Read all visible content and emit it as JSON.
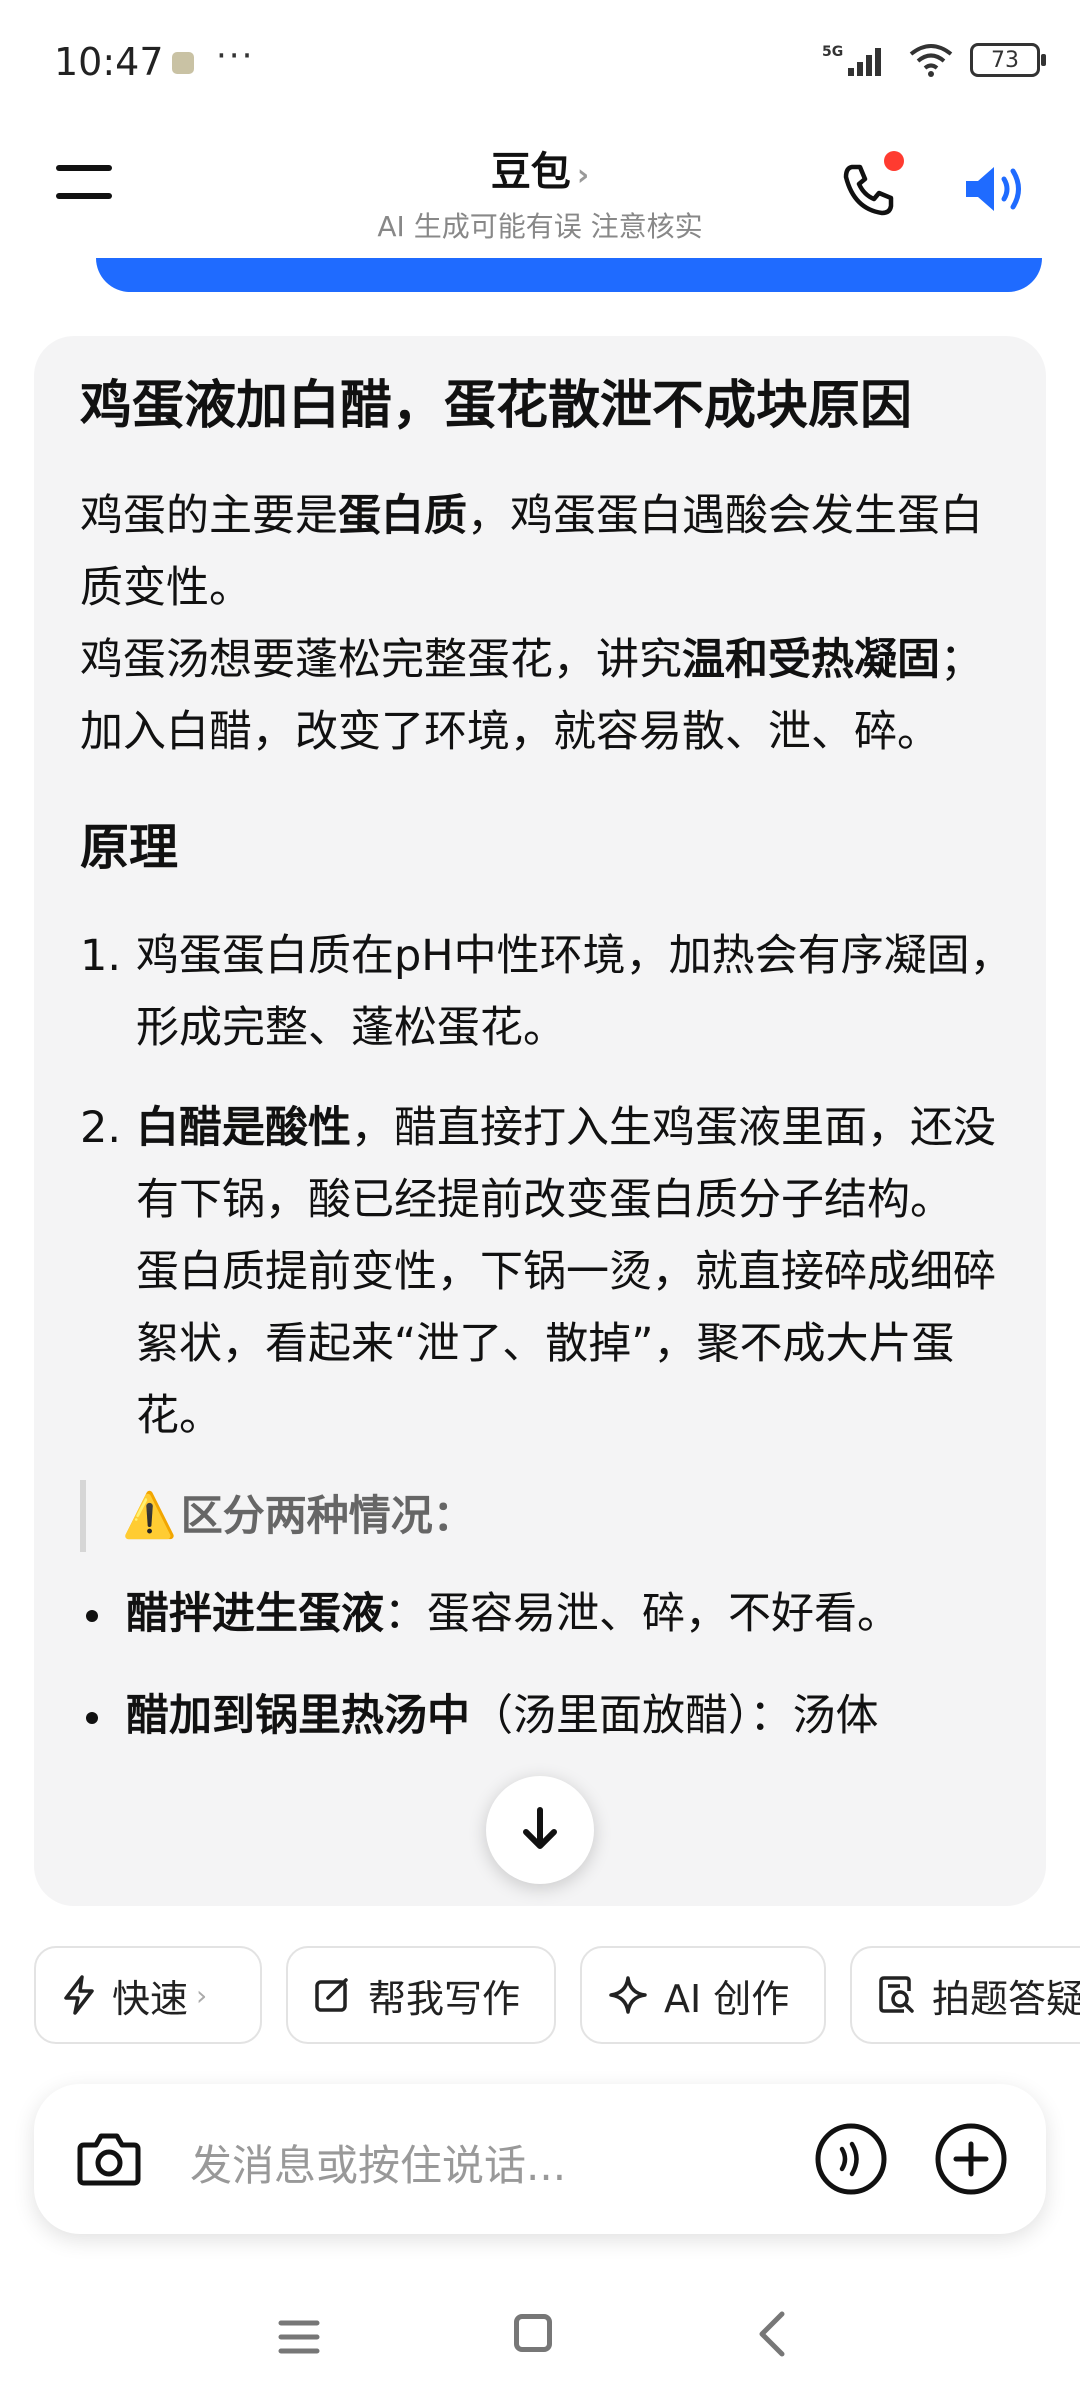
{
  "status_bar": {
    "time": "10:47",
    "dots": "···",
    "network": "5G",
    "battery": "73"
  },
  "header": {
    "title": "豆包",
    "title_chevron": "›",
    "subtitle": "AI 生成可能有误 注意核实",
    "icons": [
      "menu-icon",
      "phone-icon",
      "speaker-icon"
    ]
  },
  "message": {
    "title": "鸡蛋液加白醋，蛋花散泄不成块原因",
    "intro1_a": "鸡蛋的主要是",
    "intro1_b": "蛋白质",
    "intro1_c": "，鸡蛋蛋白遇酸会发生蛋白质变性。",
    "intro2_a": "鸡蛋汤想要蓬松完整蛋花，讲究",
    "intro2_b": "温和受热凝固",
    "intro2_c": "；加入白醋，改变了环境，就容易散、泄、碎。",
    "section_heading": "原理",
    "item1_num": "1.",
    "item1_text": "鸡蛋蛋白质在pH中性环境，加热会有序凝固，形成完整、蓬松蛋花。",
    "item2_num": "2.",
    "item2_bold": "白醋是酸性",
    "item2_text": "，醋直接打入生鸡蛋液里面，还没有下锅，酸已经提前改变蛋白质分子结构。",
    "item2_text2": "蛋白质提前变性，下锅一烫，就直接碎成细碎絮状，看起来“泄了、散掉”，聚不成大片蛋花。",
    "quote_icon": "⚠️",
    "quote_text": "区分两种情况：",
    "bullet1_bold": "醋拌进生蛋液",
    "bullet1_text": "：蛋容易泄、碎，不好看。",
    "bullet2_bold": "醋加到锅里热汤中",
    "bullet2_text": "（汤里面放醋）：汤体"
  },
  "quick_actions": [
    {
      "label": "快速",
      "icon": "lightning-icon",
      "chevron": "›"
    },
    {
      "label": "帮我写作",
      "icon": "edit-icon"
    },
    {
      "label": "AI 创作",
      "icon": "sparkle-icon"
    },
    {
      "label": "拍题答疑",
      "icon": "photo-search-icon"
    }
  ],
  "input": {
    "placeholder": "发消息或按住说话..."
  },
  "colors": {
    "accent_blue": "#1f6bff",
    "notification_red": "#ff3b30"
  }
}
